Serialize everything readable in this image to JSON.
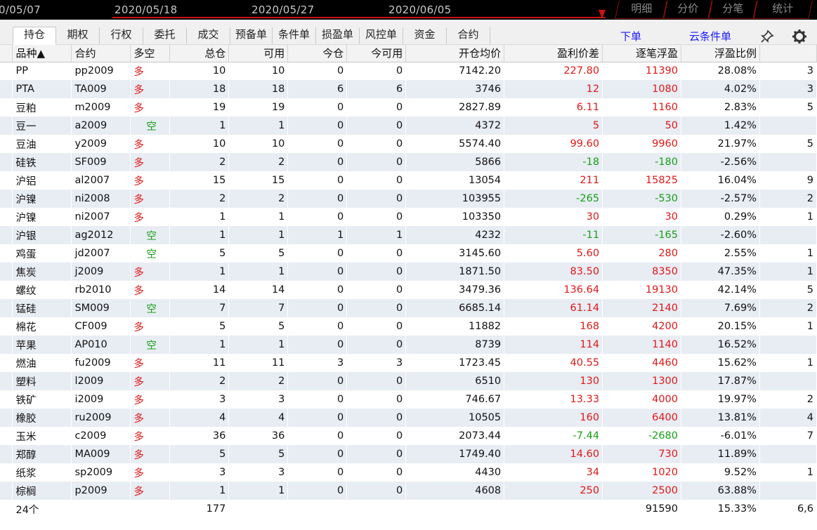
{
  "top_strip": {
    "dates": [
      "0/05/07",
      "2020/05/18",
      "2020/05/27",
      "2020/06/05"
    ],
    "right_tabs": [
      "明细",
      "分价",
      "分笔",
      "统计"
    ]
  },
  "toolbar": {
    "tabs": [
      "持仓",
      "期权",
      "行权",
      "委托",
      "成交",
      "预备单",
      "条件单",
      "损盈单",
      "风控单",
      "资金",
      "合约"
    ],
    "active_tab": "持仓",
    "order_link": "下单",
    "cloud_link": "云条件单",
    "icons": [
      "pin-icon",
      "gear-icon"
    ]
  },
  "table": {
    "headers": [
      "品种▲",
      "合约",
      "多空",
      "总仓",
      "可用",
      "今仓",
      "今可用",
      "开仓均价",
      "盈利价差",
      "逐笔浮盈",
      "浮盈比例",
      ""
    ],
    "rows": [
      {
        "name": "PP",
        "contract": "pp2009",
        "dir": "多",
        "total": "10",
        "avail": "10",
        "today": "0",
        "today_avail": "0",
        "avg_price": "7142.20",
        "diff": "227.80",
        "float_pnl": "11390",
        "ratio": "28.08%",
        "extra": "3"
      },
      {
        "name": "PTA",
        "contract": "TA009",
        "dir": "多",
        "total": "18",
        "avail": "18",
        "today": "6",
        "today_avail": "6",
        "avg_price": "3746",
        "diff": "12",
        "float_pnl": "1080",
        "ratio": "4.02%",
        "extra": "3"
      },
      {
        "name": "豆粕",
        "contract": "m2009",
        "dir": "多",
        "total": "19",
        "avail": "19",
        "today": "0",
        "today_avail": "0",
        "avg_price": "2827.89",
        "diff": "6.11",
        "float_pnl": "1160",
        "ratio": "2.83%",
        "extra": "5"
      },
      {
        "name": "豆一",
        "contract": "a2009",
        "dir": "空",
        "total": "1",
        "avail": "1",
        "today": "0",
        "today_avail": "0",
        "avg_price": "4372",
        "diff": "5",
        "float_pnl": "50",
        "ratio": "1.42%",
        "extra": ""
      },
      {
        "name": "豆油",
        "contract": "y2009",
        "dir": "多",
        "total": "10",
        "avail": "10",
        "today": "0",
        "today_avail": "0",
        "avg_price": "5574.40",
        "diff": "99.60",
        "float_pnl": "9960",
        "ratio": "21.97%",
        "extra": "5"
      },
      {
        "name": "硅铁",
        "contract": "SF009",
        "dir": "多",
        "total": "2",
        "avail": "2",
        "today": "0",
        "today_avail": "0",
        "avg_price": "5866",
        "diff": "-18",
        "float_pnl": "-180",
        "ratio": "-2.56%",
        "extra": ""
      },
      {
        "name": "沪铝",
        "contract": "al2007",
        "dir": "多",
        "total": "15",
        "avail": "15",
        "today": "0",
        "today_avail": "0",
        "avg_price": "13054",
        "diff": "211",
        "float_pnl": "15825",
        "ratio": "16.04%",
        "extra": "9"
      },
      {
        "name": "沪镍",
        "contract": "ni2008",
        "dir": "多",
        "total": "2",
        "avail": "2",
        "today": "0",
        "today_avail": "0",
        "avg_price": "103955",
        "diff": "-265",
        "float_pnl": "-530",
        "ratio": "-2.57%",
        "extra": "2"
      },
      {
        "name": "沪镍",
        "contract": "ni2007",
        "dir": "多",
        "total": "1",
        "avail": "1",
        "today": "0",
        "today_avail": "0",
        "avg_price": "103350",
        "diff": "30",
        "float_pnl": "30",
        "ratio": "0.29%",
        "extra": "1"
      },
      {
        "name": "沪银",
        "contract": "ag2012",
        "dir": "空",
        "total": "1",
        "avail": "1",
        "today": "1",
        "today_avail": "1",
        "avg_price": "4232",
        "diff": "-11",
        "float_pnl": "-165",
        "ratio": "-2.60%",
        "extra": ""
      },
      {
        "name": "鸡蛋",
        "contract": "jd2007",
        "dir": "空",
        "total": "5",
        "avail": "5",
        "today": "0",
        "today_avail": "0",
        "avg_price": "3145.60",
        "diff": "5.60",
        "float_pnl": "280",
        "ratio": "2.55%",
        "extra": "1"
      },
      {
        "name": "焦炭",
        "contract": "j2009",
        "dir": "多",
        "total": "1",
        "avail": "1",
        "today": "0",
        "today_avail": "0",
        "avg_price": "1871.50",
        "diff": "83.50",
        "float_pnl": "8350",
        "ratio": "47.35%",
        "extra": "1"
      },
      {
        "name": "螺纹",
        "contract": "rb2010",
        "dir": "多",
        "total": "14",
        "avail": "14",
        "today": "0",
        "today_avail": "0",
        "avg_price": "3479.36",
        "diff": "136.64",
        "float_pnl": "19130",
        "ratio": "42.14%",
        "extra": "5"
      },
      {
        "name": "锰硅",
        "contract": "SM009",
        "dir": "空",
        "total": "7",
        "avail": "7",
        "today": "0",
        "today_avail": "0",
        "avg_price": "6685.14",
        "diff": "61.14",
        "float_pnl": "2140",
        "ratio": "7.69%",
        "extra": "2"
      },
      {
        "name": "棉花",
        "contract": "CF009",
        "dir": "多",
        "total": "5",
        "avail": "5",
        "today": "0",
        "today_avail": "0",
        "avg_price": "11882",
        "diff": "168",
        "float_pnl": "4200",
        "ratio": "20.15%",
        "extra": "1"
      },
      {
        "name": "苹果",
        "contract": "AP010",
        "dir": "空",
        "total": "1",
        "avail": "1",
        "today": "0",
        "today_avail": "0",
        "avg_price": "8739",
        "diff": "114",
        "float_pnl": "1140",
        "ratio": "16.52%",
        "extra": ""
      },
      {
        "name": "燃油",
        "contract": "fu2009",
        "dir": "多",
        "total": "11",
        "avail": "11",
        "today": "3",
        "today_avail": "3",
        "avg_price": "1723.45",
        "diff": "40.55",
        "float_pnl": "4460",
        "ratio": "15.62%",
        "extra": "1"
      },
      {
        "name": "塑料",
        "contract": "l2009",
        "dir": "多",
        "total": "2",
        "avail": "2",
        "today": "0",
        "today_avail": "0",
        "avg_price": "6510",
        "diff": "130",
        "float_pnl": "1300",
        "ratio": "17.87%",
        "extra": ""
      },
      {
        "name": "铁矿",
        "contract": "i2009",
        "dir": "多",
        "total": "3",
        "avail": "3",
        "today": "0",
        "today_avail": "0",
        "avg_price": "746.67",
        "diff": "13.33",
        "float_pnl": "4000",
        "ratio": "19.97%",
        "extra": "2"
      },
      {
        "name": "橡胶",
        "contract": "ru2009",
        "dir": "多",
        "total": "4",
        "avail": "4",
        "today": "0",
        "today_avail": "0",
        "avg_price": "10505",
        "diff": "160",
        "float_pnl": "6400",
        "ratio": "13.81%",
        "extra": "4"
      },
      {
        "name": "玉米",
        "contract": "c2009",
        "dir": "多",
        "total": "36",
        "avail": "36",
        "today": "0",
        "today_avail": "0",
        "avg_price": "2073.44",
        "diff": "-7.44",
        "float_pnl": "-2680",
        "ratio": "-6.01%",
        "extra": "7"
      },
      {
        "name": "郑醇",
        "contract": "MA009",
        "dir": "多",
        "total": "5",
        "avail": "5",
        "today": "0",
        "today_avail": "0",
        "avg_price": "1749.40",
        "diff": "14.60",
        "float_pnl": "730",
        "ratio": "11.89%",
        "extra": ""
      },
      {
        "name": "纸浆",
        "contract": "sp2009",
        "dir": "多",
        "total": "3",
        "avail": "3",
        "today": "0",
        "today_avail": "0",
        "avg_price": "4430",
        "diff": "34",
        "float_pnl": "1020",
        "ratio": "9.52%",
        "extra": "1"
      },
      {
        "name": "棕榈",
        "contract": "p2009",
        "dir": "多",
        "total": "1",
        "avail": "1",
        "today": "0",
        "today_avail": "0",
        "avg_price": "4608",
        "diff": "250",
        "float_pnl": "2500",
        "ratio": "63.88%",
        "extra": ""
      }
    ],
    "totals": {
      "count": "24个",
      "total": "177",
      "float_pnl": "91590",
      "ratio": "15.33%",
      "extra": "6,6"
    }
  },
  "colors": {
    "profit": "#e01818",
    "loss": "#18a018",
    "header_bg": "#f3f3f3",
    "alt_row": "#e8ecf3",
    "link": "#1a1aff"
  }
}
